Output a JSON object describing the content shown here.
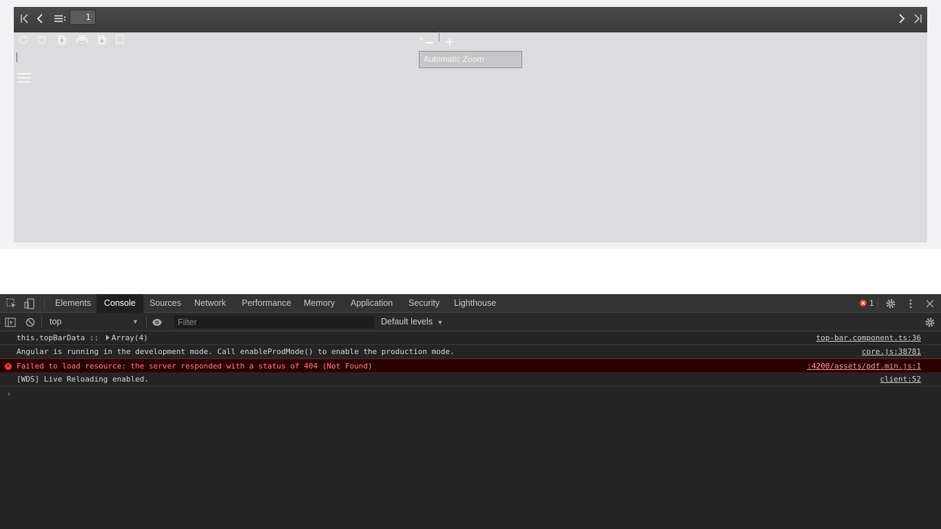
{
  "pdf_viewer": {
    "toolbar": {
      "first_page_icon": "first-page-icon",
      "previous_page_icon": "previous-page-icon",
      "outline_icon": "outline-list-icon",
      "page_number": "1",
      "next_page_icon": "next-page-icon",
      "last_page_icon": "last-page-icon"
    },
    "secondary_tools": [
      "rotate-cw-icon",
      "rotate-ccw-icon",
      "open-file-icon",
      "print-icon",
      "download-icon",
      "bookmark-icon"
    ],
    "zoom": {
      "zoom_out_label": "–",
      "zoom_in_label": "+",
      "selected": "Automatic Zoom"
    }
  },
  "devtools": {
    "tabs": [
      {
        "label": "Elements"
      },
      {
        "label": "Console"
      },
      {
        "label": "Sources"
      },
      {
        "label": "Network"
      },
      {
        "label": "Performance"
      },
      {
        "label": "Memory"
      },
      {
        "label": "Application"
      },
      {
        "label": "Security"
      },
      {
        "label": "Lighthouse"
      }
    ],
    "active_tab": "Console",
    "error_count": "1",
    "filter_bar": {
      "context": "top",
      "filter_placeholder": "Filter",
      "levels": "Default levels"
    },
    "messages": [
      {
        "level": "log",
        "text_prefix": "this.topBarData :: ",
        "expandable": "Array(4)",
        "source": "top-bar.component.ts:36"
      },
      {
        "level": "log",
        "text": "Angular is running in the development mode. Call enableProdMode() to enable the production mode.",
        "source": "core.js:38781"
      },
      {
        "level": "error",
        "text": "Failed to load resource: the server responded with a status of 404 (Not Found)",
        "source": ":4200/assets/pdf.min.js:1"
      },
      {
        "level": "log",
        "text": "[WDS] Live Reloading enabled.",
        "source": "client:52"
      }
    ],
    "prompt_symbol": "›"
  },
  "colors": {
    "toolbar_bg": "#434343",
    "viewer_bg": "#dcdcde",
    "devtools_bg": "#242424",
    "error_text": "#ff8080",
    "error_bg": "#290000",
    "prompt": "#4b8cf0"
  }
}
